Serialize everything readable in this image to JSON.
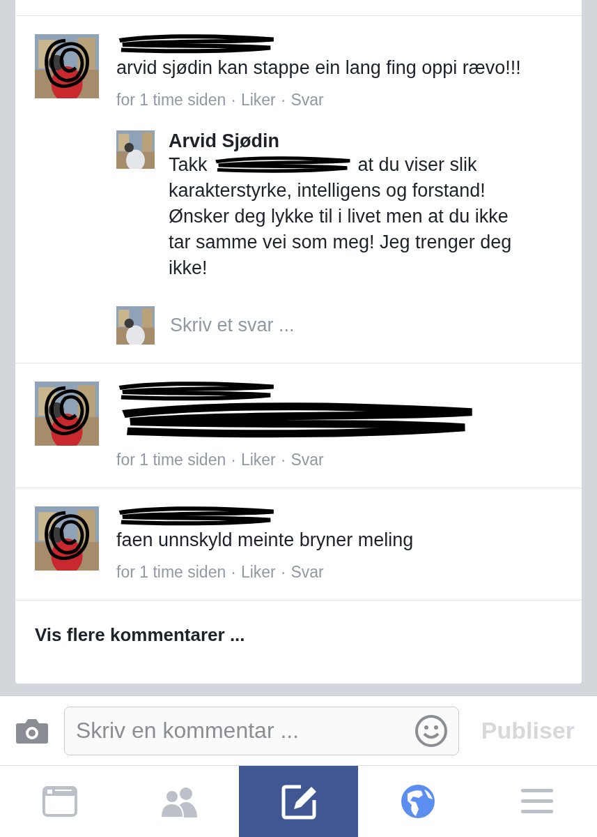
{
  "comments": [
    {
      "name_redacted": true,
      "avatar_redacted": true,
      "text": "arvid sjødin kan stappe ein lang fing oppi rævo!!!",
      "meta": {
        "time": "for 1 time siden",
        "sep": "·",
        "like": "Liker",
        "reply": "Svar"
      },
      "replies": [
        {
          "name": "Arvid Sjødin",
          "text_before": "Takk",
          "text_after": "at du viser slik",
          "text_rest": "karakterstyrke, intelligens og forstand! Ønsker deg lykke til i livet men at du ikke tar samme vei som meg! Jeg trenger deg ikke!"
        }
      ],
      "reply_field": {
        "placeholder": "Skriv et svar ..."
      }
    },
    {
      "name_redacted": true,
      "avatar_redacted": true,
      "text_redacted": true,
      "meta": {
        "time": "for 1 time siden",
        "sep": "·",
        "like": "Liker",
        "reply": "Svar"
      }
    },
    {
      "name_redacted": true,
      "avatar_redacted": true,
      "text": "faen unnskyld meinte bryner meling",
      "meta": {
        "time": "for 1 time siden",
        "sep": "·",
        "like": "Liker",
        "reply": "Svar"
      }
    }
  ],
  "more_comments": "Vis flere kommentarer ...",
  "composer": {
    "placeholder": "Skriv en kommentar ...",
    "publish": "Publiser",
    "publish_disabled": true
  },
  "tab_bar": [
    {
      "kind": "feed",
      "selected": false
    },
    {
      "kind": "friends",
      "selected": false
    },
    {
      "kind": "compose",
      "selected": true
    },
    {
      "kind": "globe",
      "selected": false
    },
    {
      "kind": "menu",
      "selected": false
    }
  ]
}
